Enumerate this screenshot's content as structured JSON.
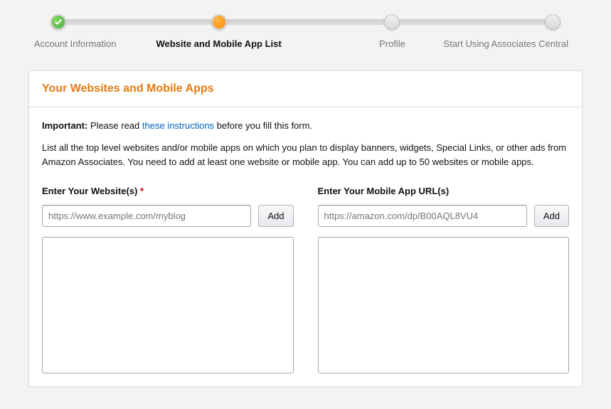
{
  "progress": {
    "steps": [
      {
        "label": "Account Information",
        "state": "completed"
      },
      {
        "label": "Website and Mobile App List",
        "state": "active"
      },
      {
        "label": "Profile",
        "state": "pending"
      },
      {
        "label": "Start Using Associates Central",
        "state": "pending"
      }
    ]
  },
  "card": {
    "title": "Your Websites and Mobile Apps",
    "important_label": "Important:",
    "important_text_before": " Please read ",
    "instructions_link": "these instructions",
    "important_text_after": " before you fill this form.",
    "description": "List all the top level websites and/or mobile apps on which you plan to display banners, widgets, Special Links, or other ads from Amazon Associates. You need to add at least one website or mobile app. You can add up to 50 websites or mobile apps."
  },
  "websites": {
    "label": "Enter Your Website(s)",
    "required": "*",
    "placeholder": "https://www.example.com/myblog",
    "add_button": "Add"
  },
  "mobileapps": {
    "label": "Enter Your Mobile App URL(s)",
    "placeholder": "https://amazon.com/dp/B00AQL8VU4",
    "add_button": "Add"
  }
}
